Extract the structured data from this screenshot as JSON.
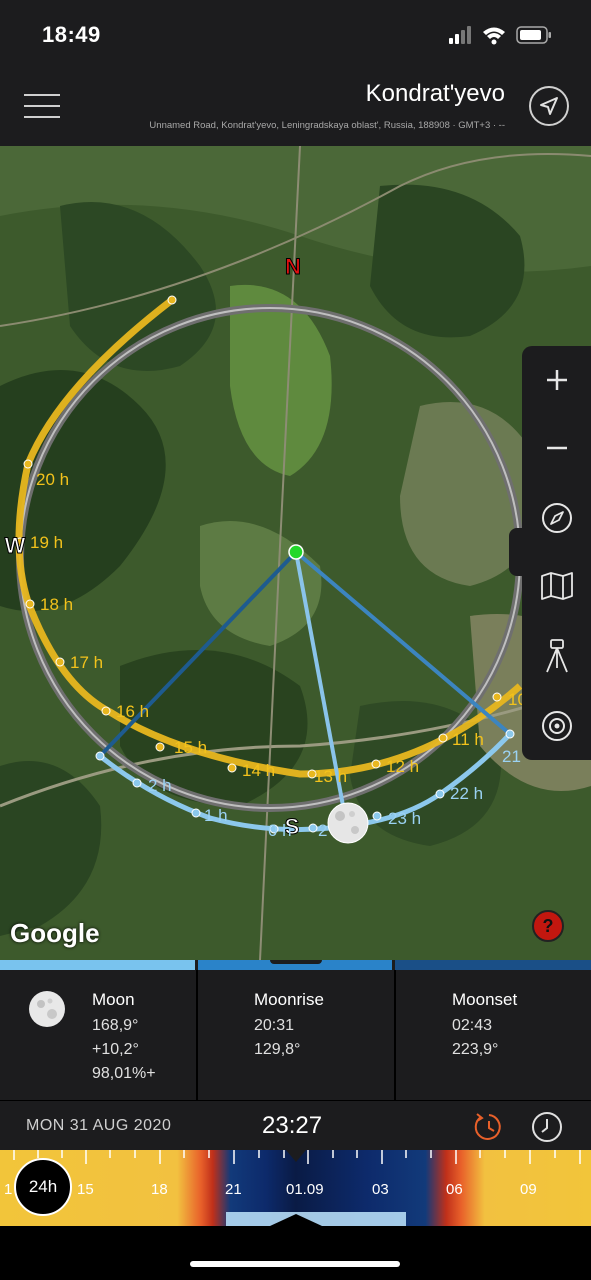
{
  "status_bar": {
    "time": "18:49"
  },
  "header": {
    "title": "Kondrat'yevo",
    "address": "Unnamed Road, Kondrat'yevo, Leningradskaya oblast', Russia, 188908 · GMT+3 · --"
  },
  "map": {
    "compass": {
      "north": "N",
      "west": "W",
      "south": "S"
    },
    "sun_hours": [
      "20 h",
      "19 h",
      "18 h",
      "17 h",
      "16 h",
      "15 h",
      "14 h",
      "13 h",
      "12 h",
      "11 h",
      "10"
    ],
    "moon_hours": [
      "2 h",
      "1 h",
      "0 h",
      "2",
      "23 h",
      "22 h",
      "21"
    ],
    "attribution": "Google",
    "help_label": "?"
  },
  "toolbar": {
    "items": [
      {
        "icon": "zoom-in-icon",
        "label": "+"
      },
      {
        "icon": "zoom-out-icon",
        "label": "−"
      },
      {
        "icon": "compass-icon"
      },
      {
        "icon": "map-layers-icon"
      },
      {
        "icon": "tripod-icon"
      },
      {
        "icon": "target-icon"
      }
    ]
  },
  "info": {
    "moon": {
      "title": "Moon",
      "azimuth": "168,9°",
      "elevation": "+10,2°",
      "illumination": "98,01%+"
    },
    "moonrise": {
      "title": "Moonrise",
      "time": "20:31",
      "azimuth": "129,8°"
    },
    "moonset": {
      "title": "Moonset",
      "time": "02:43",
      "azimuth": "223,9°"
    }
  },
  "datetime": {
    "date": "MON 31 AUG 2020",
    "time": "23:27"
  },
  "timeline": {
    "mode": "24h",
    "labels": [
      "1",
      "15",
      "18",
      "21",
      "01.09",
      "03",
      "06",
      "09"
    ]
  },
  "colors": {
    "sun_path": "#e8b71f",
    "moon_path": "#8cc8ec",
    "night_blue": "#0d2a6b",
    "accent_orange": "#e8602a"
  }
}
